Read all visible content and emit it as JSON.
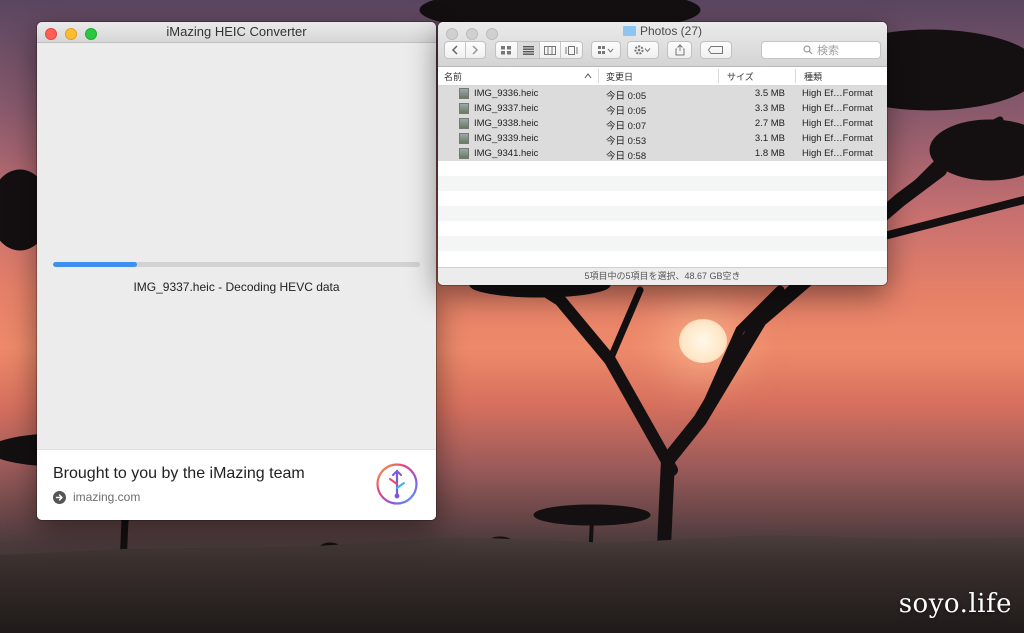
{
  "desktop": {
    "watermark": "soyo.life"
  },
  "converter": {
    "title": "iMazing HEIC Converter",
    "progress_percent": 23,
    "status": "IMG_9337.heic - Decoding HEVC data",
    "footer_headline": "Brought to you by the iMazing team",
    "footer_link": "imazing.com"
  },
  "finder": {
    "title": "Photos (27)",
    "search_placeholder": "検索",
    "columns": {
      "name": "名前",
      "modified": "変更日",
      "size": "サイズ",
      "kind": "種類"
    },
    "files": [
      {
        "name": "IMG_9336.heic",
        "modified": "今日 0:05",
        "size": "3.5 MB",
        "kind": "High Ef…Format"
      },
      {
        "name": "IMG_9337.heic",
        "modified": "今日 0:05",
        "size": "3.3 MB",
        "kind": "High Ef…Format"
      },
      {
        "name": "IMG_9338.heic",
        "modified": "今日 0:07",
        "size": "2.7 MB",
        "kind": "High Ef…Format"
      },
      {
        "name": "IMG_9339.heic",
        "modified": "今日 0:53",
        "size": "3.1 MB",
        "kind": "High Ef…Format"
      },
      {
        "name": "IMG_9341.heic",
        "modified": "今日 0:58",
        "size": "1.8 MB",
        "kind": "High Ef…Format"
      }
    ],
    "status": "5項目中の5項目を選択、48.67 GB空き"
  },
  "colors": {
    "accent": "#3d8ff0",
    "close": "#ff5f57",
    "minimize": "#febc2e",
    "zoom": "#28c840"
  }
}
